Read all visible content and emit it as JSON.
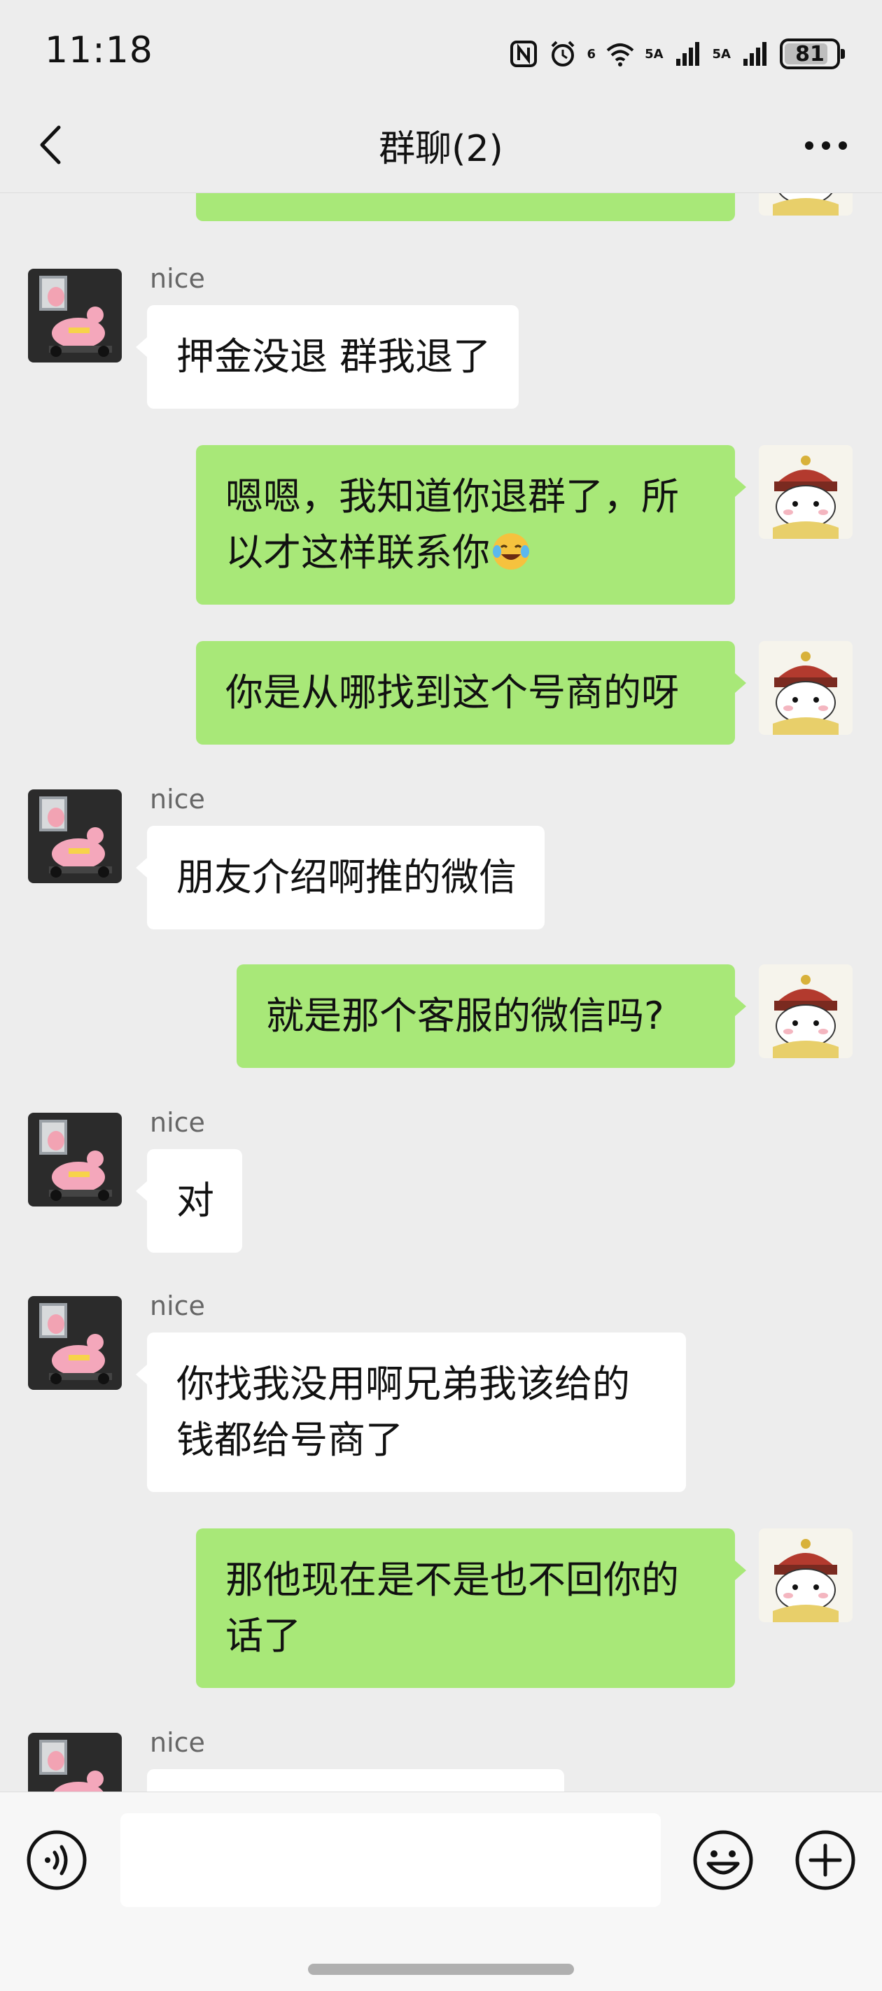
{
  "status_bar": {
    "time": "11:18",
    "network_1": "5A",
    "network_2": "5A",
    "wifi_badge": "6",
    "battery": "81"
  },
  "header": {
    "title": "群聊(2)"
  },
  "contacts": {
    "other_name": "nice"
  },
  "messages": [
    {
      "sender": "nice",
      "side": "left",
      "text": "押金没退 群我退了"
    },
    {
      "sender": "me",
      "side": "right",
      "text": "嗯嗯，我知道你退群了，所以才这样联系你",
      "emoji": "laugh-cry"
    },
    {
      "sender": "me",
      "side": "right",
      "text": "你是从哪找到这个号商的呀"
    },
    {
      "sender": "nice",
      "side": "left",
      "text": "朋友介绍啊推的微信"
    },
    {
      "sender": "me",
      "side": "right",
      "text": "就是那个客服的微信吗?"
    },
    {
      "sender": "nice",
      "side": "left",
      "text": "对"
    },
    {
      "sender": "nice",
      "side": "left",
      "text": "你找我没用啊兄弟我该给的钱都给号商了"
    },
    {
      "sender": "me",
      "side": "right",
      "text": "那他现在是不是也不回你的话了"
    }
  ],
  "input_bar": {
    "placeholder": ""
  },
  "colors": {
    "background": "#ededed",
    "my_bubble": "#a8e878",
    "their_bubble": "#ffffff"
  }
}
